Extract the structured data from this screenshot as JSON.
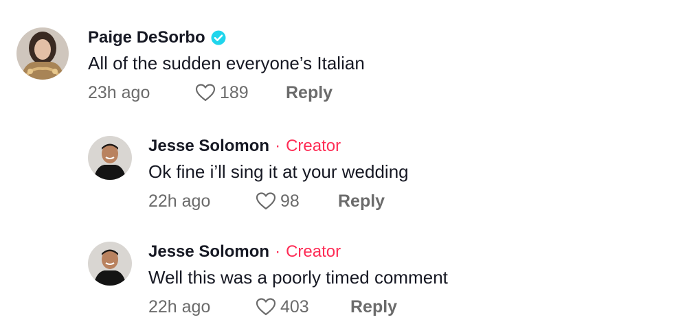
{
  "comments": [
    {
      "username": "Paige DeSorbo",
      "verified": true,
      "text": "All of the sudden everyone’s Italian",
      "time": "23h ago",
      "likes": "189",
      "reply_label": "Reply"
    },
    {
      "username": "Jesse Solomon",
      "separator": "·",
      "badge": "Creator",
      "text": "Ok fine i’ll sing it at your wedding",
      "time": "22h ago",
      "likes": "98",
      "reply_label": "Reply"
    },
    {
      "username": "Jesse Solomon",
      "separator": "·",
      "badge": "Creator",
      "text": "Well this was a poorly timed comment",
      "time": "22h ago",
      "likes": "403",
      "reply_label": "Reply"
    }
  ],
  "colors": {
    "creator_accent": "#fe2c55",
    "verified_badge": "#20d5ec",
    "secondary_text": "#6b6b6b"
  }
}
